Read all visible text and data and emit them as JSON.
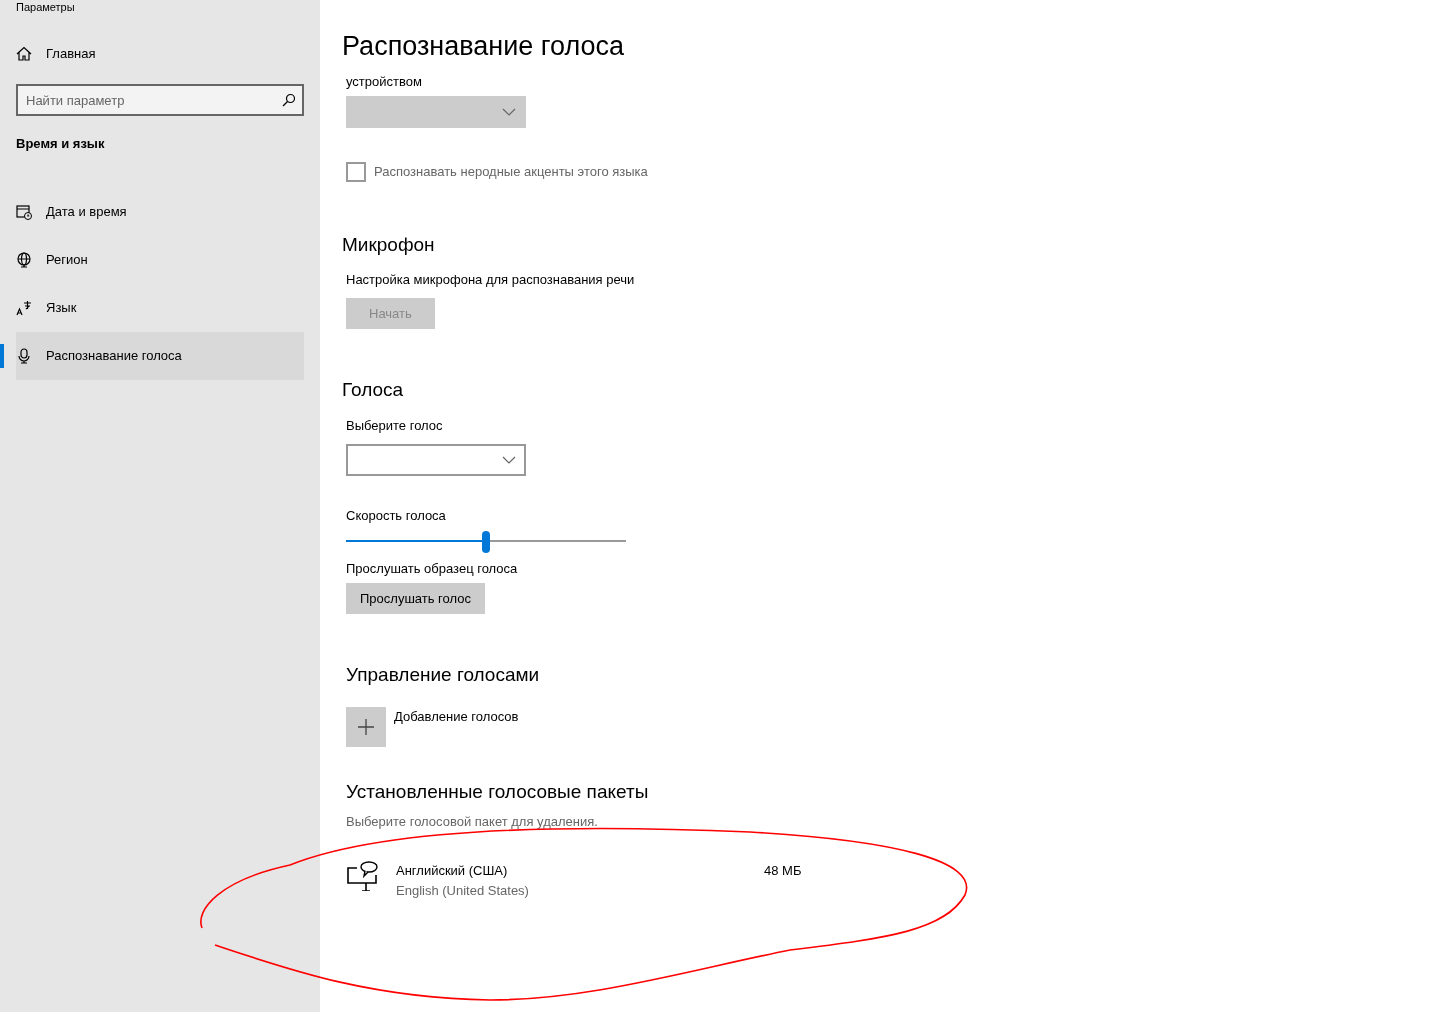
{
  "window": {
    "title": "Параметры"
  },
  "sidebar": {
    "home": "Главная",
    "search": {
      "placeholder": "Найти параметр"
    },
    "section": "Время и язык",
    "items": [
      {
        "label": "Дата и время",
        "selected": false
      },
      {
        "label": "Регион",
        "selected": false
      },
      {
        "label": "Язык",
        "selected": false
      },
      {
        "label": "Распознавание голоса",
        "selected": true
      }
    ]
  },
  "page": {
    "title": "Распознавание голоса",
    "device_label": "устройством",
    "device_dropdown": {
      "disabled": true
    },
    "accent_checkbox": {
      "label": "Распознавать неродные акценты этого языка",
      "checked": false,
      "disabled": true
    },
    "microphone": {
      "heading": "Микрофон",
      "text": "Настройка микрофона для распознавания речи",
      "button": {
        "label": "Начать",
        "disabled": true
      }
    },
    "voices": {
      "heading": "Голоса",
      "choose_label": "Выберите голос",
      "voice_dropdown": {
        "disabled": false
      },
      "speed_label": "Скорость голоса",
      "speed": {
        "level": 0.5
      },
      "sample_label": "Прослушать образец голоса",
      "sample_button": {
        "label": "Прослушать голос",
        "disabled": false
      }
    },
    "manage": {
      "heading": "Управление голосами",
      "add": "Добавление голосов"
    },
    "installed": {
      "heading": "Установленные голосовые пакеты",
      "hint": "Выберите голосовой пакет для удаления.",
      "packages": [
        {
          "name": "Английский (США)",
          "subtitle": "English (United States)",
          "size": "48 МБ"
        }
      ]
    }
  },
  "annotation": {
    "kind": "freehand-ellipse",
    "color": "#ff0000"
  }
}
